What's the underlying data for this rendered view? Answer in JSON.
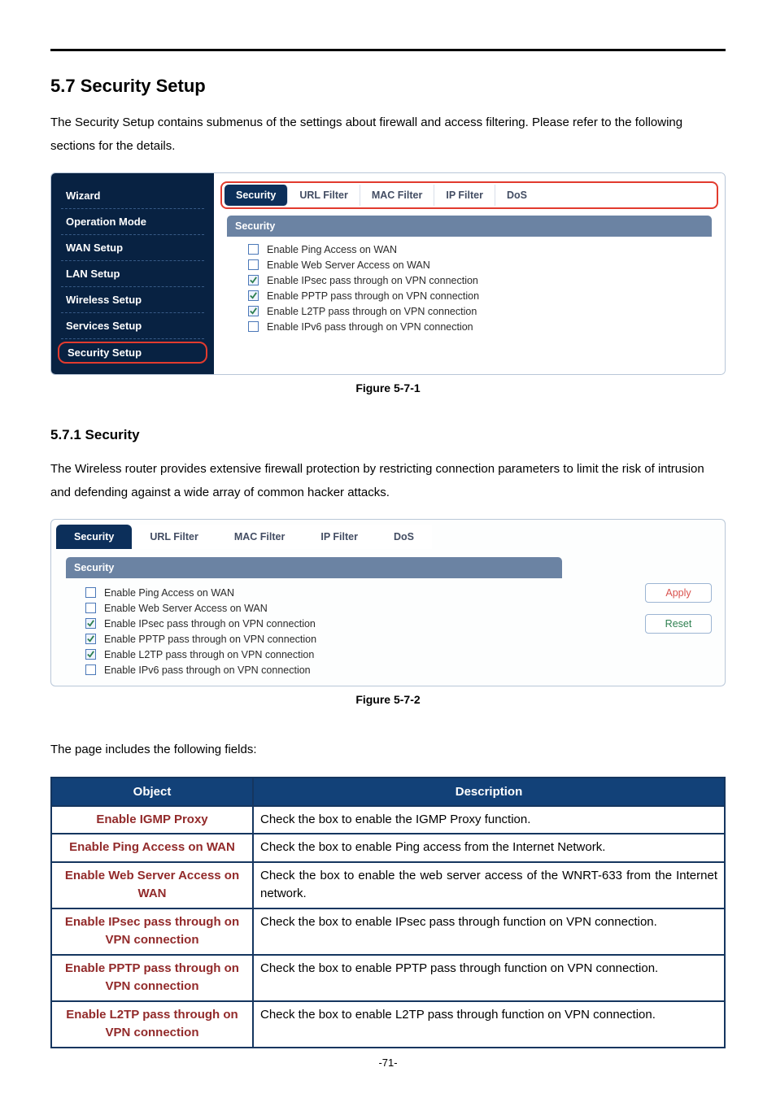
{
  "section": {
    "number_title": "5.7  Security Setup",
    "intro": "The Security Setup contains submenus of the settings about firewall and access filtering. Please refer to the following sections for the details."
  },
  "fig1": {
    "caption": "Figure 5-7-1",
    "sidebar": {
      "wizard": "Wizard",
      "items": [
        "Operation Mode",
        "WAN Setup",
        "LAN Setup",
        "Wireless Setup",
        "Services Setup"
      ],
      "active": "Security Setup"
    },
    "tabs": [
      "Security",
      "URL Filter",
      "MAC Filter",
      "IP Filter",
      "DoS"
    ],
    "panel_title": "Security",
    "options": [
      {
        "label": "Enable Ping Access on WAN",
        "checked": false
      },
      {
        "label": "Enable Web Server Access on WAN",
        "checked": false
      },
      {
        "label": "Enable IPsec pass through on VPN connection",
        "checked": true
      },
      {
        "label": "Enable PPTP pass through on VPN connection",
        "checked": true
      },
      {
        "label": "Enable L2TP pass through on VPN connection",
        "checked": true
      },
      {
        "label": "Enable IPv6 pass through on VPN connection",
        "checked": false
      }
    ]
  },
  "subsection": {
    "number_title": "5.7.1  Security",
    "body": "The Wireless router provides extensive firewall protection by restricting connection parameters to limit the risk of intrusion and defending against a wide array of common hacker attacks."
  },
  "fig2": {
    "caption": "Figure 5-7-2",
    "tabs": [
      "Security",
      "URL Filter",
      "MAC Filter",
      "IP Filter",
      "DoS"
    ],
    "panel_title": "Security",
    "options": [
      {
        "label": "Enable Ping Access on WAN",
        "checked": false
      },
      {
        "label": "Enable Web Server Access on WAN",
        "checked": false
      },
      {
        "label": "Enable IPsec pass through on VPN connection",
        "checked": true
      },
      {
        "label": "Enable PPTP pass through on VPN connection",
        "checked": true
      },
      {
        "label": "Enable L2TP pass through on VPN connection",
        "checked": true
      },
      {
        "label": "Enable IPv6 pass through on VPN connection",
        "checked": false
      }
    ],
    "buttons": {
      "apply": "Apply",
      "reset": "Reset"
    }
  },
  "fields": {
    "intro": "The page includes the following fields:",
    "head_object": "Object",
    "head_description": "Description",
    "rows": [
      {
        "object": "Enable IGMP Proxy",
        "desc": "Check the box to enable the IGMP Proxy function."
      },
      {
        "object": "Enable Ping Access on WAN",
        "desc": "Check the box to enable Ping access from the Internet Network."
      },
      {
        "object": "Enable Web Server Access on WAN",
        "desc": "Check the box to enable the web server access of the WNRT-633 from the Internet network."
      },
      {
        "object": "Enable IPsec pass through on VPN connection",
        "desc": "Check the box to enable IPsec pass through function on VPN connection."
      },
      {
        "object": "Enable PPTP pass through on VPN connection",
        "desc": "Check the box to enable PPTP pass through function on VPN connection."
      },
      {
        "object": "Enable L2TP pass through on VPN connection",
        "desc": "Check the box to enable L2TP pass through function on VPN connection."
      }
    ]
  },
  "page_number": "-71-"
}
